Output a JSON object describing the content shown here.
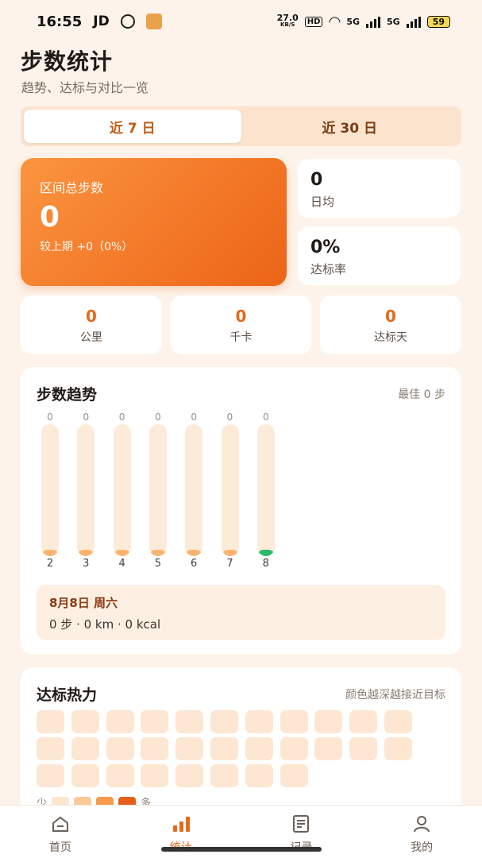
{
  "status": {
    "time": "16:55",
    "carrier": "JD",
    "speed": "27.0",
    "speed_unit": "KB/S",
    "hd": "HD",
    "sig1": "5G",
    "sig2": "5G",
    "battery": "59"
  },
  "page": {
    "title": "步数统计",
    "subtitle": "趋势、达标与对比一览"
  },
  "tabs": [
    {
      "label": "近 7 日",
      "active": true
    },
    {
      "label": "近 30 日",
      "active": false
    }
  ],
  "hero": {
    "label": "区间总步数",
    "value": "0",
    "compare": "较上期 +0（0%）"
  },
  "side_stats": [
    {
      "value": "0",
      "label": "日均"
    },
    {
      "value": "0%",
      "label": "达标率"
    }
  ],
  "row_stats": [
    {
      "value": "0",
      "label": "公里"
    },
    {
      "value": "0",
      "label": "千卡"
    },
    {
      "value": "0",
      "label": "达标天"
    }
  ],
  "trend": {
    "title": "步数趋势",
    "best": "最佳 0 步",
    "detail_date": "8月8日 周六",
    "detail_summary": "0 步 · 0 km · 0 kcal"
  },
  "chart_data": {
    "type": "bar",
    "categories": [
      "2",
      "3",
      "4",
      "5",
      "6",
      "7",
      "8"
    ],
    "values": [
      0,
      0,
      0,
      0,
      0,
      0,
      0
    ],
    "value_labels": [
      "0",
      "0",
      "0",
      "0",
      "0",
      "0",
      "0"
    ],
    "highlight_index": 6,
    "colors": {
      "bar": "#fbb46e",
      "today": "#2bb96a",
      "track": "#fdebd9"
    }
  },
  "heatmap": {
    "title": "达标热力",
    "note": "颜色越深越接近目标",
    "cells": 30,
    "legend_low": "少",
    "legend_high": "多",
    "legend_colors": [
      "#fde6d2",
      "#fbc995",
      "#f59a4e",
      "#e4601a"
    ]
  },
  "nav": [
    {
      "label": "首页",
      "icon": "home-icon",
      "active": false
    },
    {
      "label": "统计",
      "icon": "bar-chart-icon",
      "active": true
    },
    {
      "label": "记录",
      "icon": "document-icon",
      "active": false
    },
    {
      "label": "我的",
      "icon": "user-icon",
      "active": false
    }
  ],
  "colors": {
    "accent": "#e46a1c",
    "background": "#fdf3ea"
  }
}
